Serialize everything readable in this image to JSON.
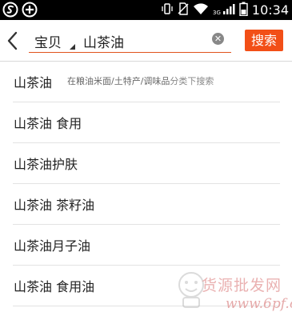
{
  "status_bar": {
    "left_icons": [
      "sogou-icon",
      "add-circle-icon"
    ],
    "right_icons": [
      "vibrate-icon",
      "no-sim-icon",
      "wifi-icon",
      "signal-icon",
      "battery-icon"
    ],
    "network": "3G",
    "time": "10:34"
  },
  "search": {
    "scope": "宝贝",
    "query": "山茶油",
    "button_label": "搜索",
    "accent_color": "#f24f17"
  },
  "suggestions": [
    {
      "text": "山茶油",
      "hint_categories": "在粮油米面/土特产/调味品",
      "hint_suffix": "分类下搜索"
    },
    {
      "text": "山茶油 食用"
    },
    {
      "text": "山茶油护肤"
    },
    {
      "text": "山茶油 茶籽油"
    },
    {
      "text": "山茶油月子油"
    },
    {
      "text": "山茶油 食用油"
    }
  ],
  "watermark": {
    "chinese": "货源批发网",
    "url": "www.6pf.cn"
  }
}
